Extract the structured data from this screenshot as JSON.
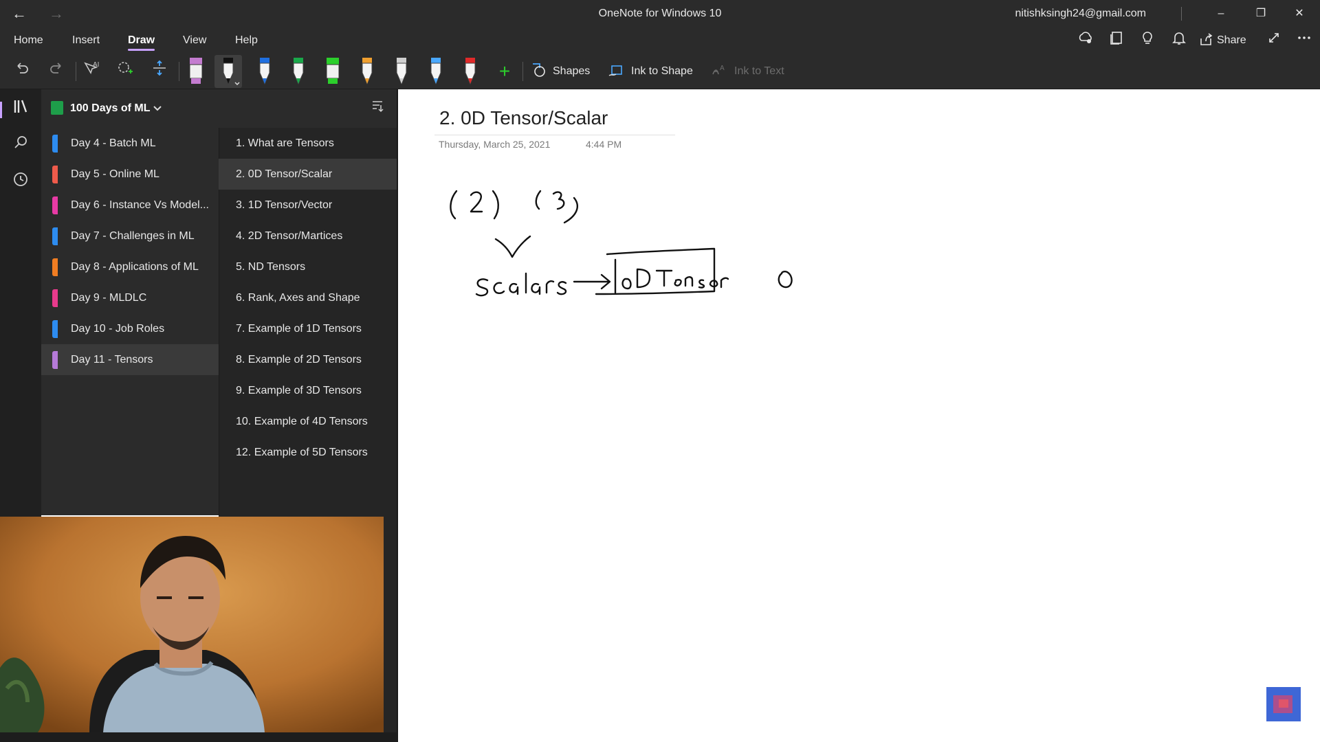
{
  "app": {
    "title": "OneNote for Windows 10",
    "account": "nitishksingh24@gmail.com"
  },
  "window_controls": {
    "minimize_glyph": "–",
    "restore_glyph": "❐",
    "close_glyph": "✕"
  },
  "nav": {
    "back_glyph": "←",
    "forward_glyph": "→"
  },
  "ribbon": {
    "tabs": [
      "Home",
      "Insert",
      "Draw",
      "View",
      "Help"
    ],
    "active_tab": "Draw",
    "share_label": "Share",
    "right_icons": [
      "sync-icon",
      "notebook-icon",
      "lightbulb-icon",
      "bell-icon",
      "share-icon",
      "fullscreen-icon",
      "more-icon"
    ]
  },
  "toolbar": {
    "shapes_label": "Shapes",
    "ink_to_shape_label": "Ink to Shape",
    "ink_to_text_label": "Ink to Text",
    "add_pen_glyph": "+",
    "pens": [
      {
        "color": "#c47cd0",
        "type": "highlighter"
      },
      {
        "color": "#111111",
        "type": "pen",
        "selected": true
      },
      {
        "color": "#1f6fe0",
        "type": "pen"
      },
      {
        "color": "#1aa84a",
        "type": "pen"
      },
      {
        "color": "#2ccf2c",
        "type": "highlighter"
      },
      {
        "color": "#f0a030",
        "type": "pen"
      },
      {
        "color": "#cfcfcf",
        "type": "pen"
      },
      {
        "color": "#4aa8ff",
        "type": "pen"
      },
      {
        "color": "#e02a2a",
        "type": "pen"
      }
    ]
  },
  "notebook": {
    "name": "100 Days of ML",
    "color": "#1e9e4a"
  },
  "sections": [
    {
      "label": "Day 4 - Batch ML",
      "color": "#2d8cf0"
    },
    {
      "label": "Day 5 - Online ML",
      "color": "#ef5b4b"
    },
    {
      "label": "Day 6 - Instance Vs Model...",
      "color": "#e83aa5"
    },
    {
      "label": "Day 7 - Challenges in ML",
      "color": "#2d8cf0"
    },
    {
      "label": "Day 8 - Applications of ML",
      "color": "#f07d22"
    },
    {
      "label": "Day 9 - MLDLC",
      "color": "#e83a8c"
    },
    {
      "label": "Day 10 - Job Roles",
      "color": "#2d8cf0"
    },
    {
      "label": "Day 11 - Tensors",
      "color": "#b57ad8",
      "selected": true
    }
  ],
  "pages": [
    {
      "label": "1. What are Tensors"
    },
    {
      "label": "2. 0D Tensor/Scalar",
      "selected": true
    },
    {
      "label": "3. 1D Tensor/Vector"
    },
    {
      "label": "4. 2D Tensor/Martices"
    },
    {
      "label": "5. ND Tensors"
    },
    {
      "label": "6. Rank, Axes and Shape"
    },
    {
      "label": "7. Example of 1D Tensors"
    },
    {
      "label": "8. Example of 2D Tensors"
    },
    {
      "label": "9. Example of 3D Tensors"
    },
    {
      "label": "10. Example of 4D Tensors"
    },
    {
      "label": "12. Example of 5D Tensors"
    }
  ],
  "page": {
    "title": "2. 0D Tensor/Scalar",
    "date": "Thursday, March 25, 2021",
    "time": "4:44 PM",
    "ink_text": [
      "(2)",
      "(3)",
      "Scalars",
      "0D Tensor"
    ]
  }
}
